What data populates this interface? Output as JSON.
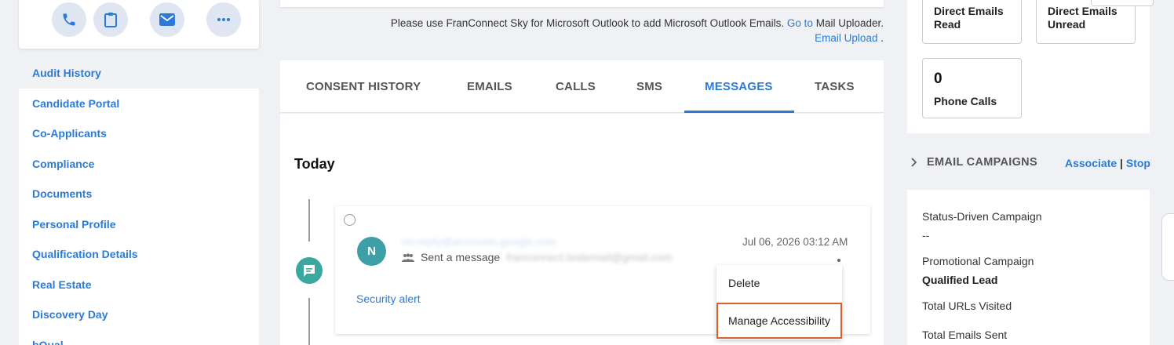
{
  "actions": [
    {
      "name": "phone-icon"
    },
    {
      "name": "clipboard-icon"
    },
    {
      "name": "email-icon"
    },
    {
      "name": "more-icon"
    }
  ],
  "sidebar": {
    "items": [
      "Audit History",
      "Candidate Portal",
      "Co-Applicants",
      "Compliance",
      "Documents",
      "Personal Profile",
      "Qualification Details",
      "Real Estate",
      "Discovery Day",
      "bQual"
    ]
  },
  "notice": {
    "text": "Please use FranConnect Sky for Microsoft Outlook to add Microsoft Outlook Emails.",
    "goto": "Go to",
    "uploader": "Mail Uploader.",
    "email_upload": "Email Upload",
    "period": "."
  },
  "tabs": [
    "CONSENT HISTORY",
    "EMAILS",
    "CALLS",
    "SMS",
    "MESSAGES",
    "TASKS"
  ],
  "active_tab": "MESSAGES",
  "timeline": {
    "heading": "Today",
    "message": {
      "avatar_letter": "N",
      "from": "no-reply@accounts.google.com",
      "sent_prefix": "Sent a message",
      "to": "franconnect.testemail@gmail.com",
      "date": "Jul 06, 2026 03:12 AM",
      "subject": "Security alert"
    },
    "menu": [
      "Delete",
      "Manage Accessibility"
    ]
  },
  "stats": {
    "direct_read": "Direct Emails Read",
    "direct_unread": "Direct Emails Unread",
    "phone_calls_count": "0",
    "phone_calls_label": "Phone Calls"
  },
  "campaigns": {
    "title": "EMAIL CAMPAIGNS",
    "associate": "Associate",
    "sep": "|",
    "stop": "Stop",
    "status_driven_label": "Status-Driven Campaign",
    "status_driven_value": "--",
    "promotional_label": "Promotional Campaign",
    "promotional_value": "Qualified Lead",
    "urls_visited": "Total URLs Visited",
    "emails_sent": "Total Emails Sent"
  },
  "colors": {
    "accent": "#2b7bd6",
    "teal": "#3aa8a0",
    "highlight": "#d5622a"
  }
}
